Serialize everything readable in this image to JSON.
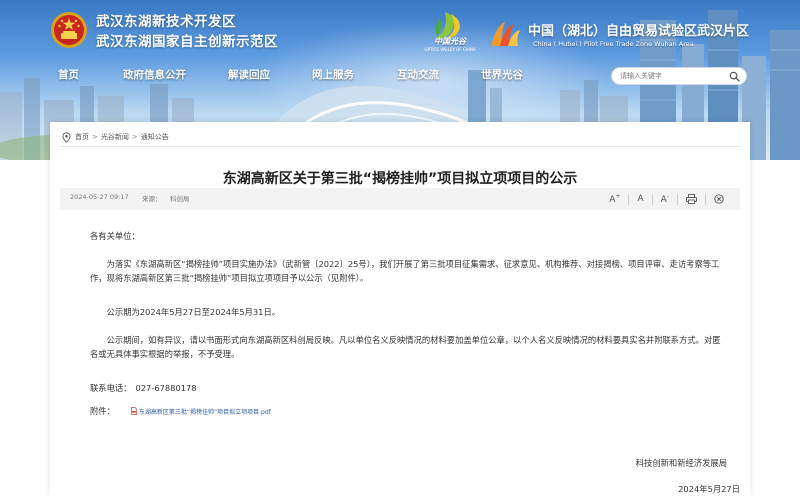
{
  "header": {
    "title_line1": "武汉东湖新技术开发区",
    "title_line2": "武汉东湖国家自主创新示范区",
    "optics_logo_text": "中国光谷",
    "optics_logo_sub": "OPTICS VALLEY OF CHINA",
    "ftz_title": "中国（湖北）自由贸易试验区武汉片区",
    "ftz_subtitle": "China ( Hubei ) Pilot Free Trade Zone Wuhan Area"
  },
  "nav": {
    "items": [
      {
        "label": "首页"
      },
      {
        "label": "政府信息公开"
      },
      {
        "label": "解读回应"
      },
      {
        "label": "网上服务"
      },
      {
        "label": "互动交流"
      },
      {
        "label": "世界光谷"
      }
    ]
  },
  "search": {
    "placeholder": "请输入关键字"
  },
  "breadcrumb": {
    "items": [
      "首页",
      "光谷新闻",
      "通知公告"
    ],
    "separator": ">"
  },
  "article": {
    "title": "东湖高新区关于第三批“揭榜挂帅”项目拟立项项目的公示",
    "date": "2024-05-27 09:17",
    "source_label": "来源：",
    "source": "科创局",
    "tools": {
      "font_larger": "A",
      "font_normal": "A",
      "font_smaller": "A"
    },
    "greeting": "各有关单位：",
    "paragraphs": [
      "为落实《东湖高新区“揭榜挂帅”项目实施办法》（武新管〔2022〕25号），我们开展了第三批项目征集需求、征求意见、机构推荐、对接揭榜、项目评审、走访考察等工作，现将东湖高新区第三批“揭榜挂帅”项目拟立项项目予以公示（见附件）。",
      "公示期为2024年5月27日至2024年5月31日。",
      "公示期间，如有异议，请以书面形式向东湖高新区科创局反映。凡以单位名义反映情况的材料要加盖单位公章，以个人名义反映情况的材料要具实名并附联系方式。对匿名或无具体事实根据的举报，不予受理。"
    ],
    "phone_label": "联系电话：",
    "phone": "027-67880178",
    "attachment_label": "附件：",
    "attachment_name": "东湖高新区第三批“揭榜挂帅”项目拟立项项目.pdf",
    "signature_org": "科技创新和新经济发展局",
    "signature_date": "2024年5月27日"
  },
  "colors": {
    "banner_top": "#3a78c4",
    "link": "#2b5aa8",
    "text": "#333333",
    "meta_bg": "#f3f3f3"
  }
}
